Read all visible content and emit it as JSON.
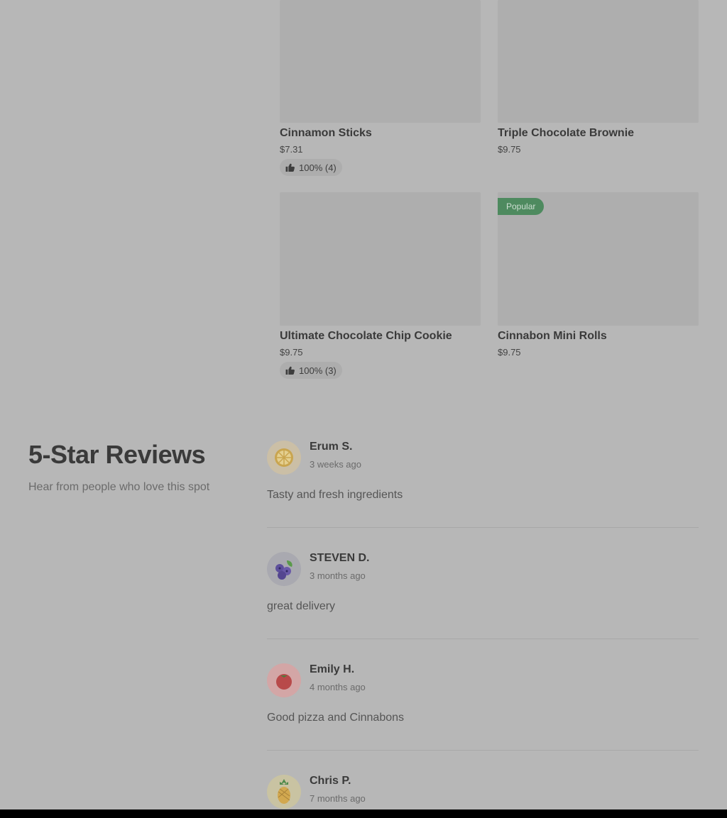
{
  "products": [
    {
      "name": "Cinnamon Sticks",
      "price": "$7.31",
      "rating": "100% (4)"
    },
    {
      "name": "Triple Chocolate Brownie",
      "price": "$9.75"
    },
    {
      "name": "Ultimate Chocolate Chip Cookie",
      "price": "$9.75",
      "rating": "100% (3)"
    },
    {
      "name": "Cinnabon Mini Rolls",
      "price": "$9.75",
      "badge": "Popular"
    }
  ],
  "reviews_section": {
    "title": "5-Star Reviews",
    "subtitle": "Hear from people who love this spot",
    "reviews": [
      {
        "author": "Erum S.",
        "when": "3 weeks ago",
        "text": "Tasty and fresh ingredients",
        "avatar_icon": "lemon-icon"
      },
      {
        "author": "STEVEN D.",
        "when": "3 months ago",
        "text": "great delivery",
        "avatar_icon": "blueberries-icon"
      },
      {
        "author": "Emily H.",
        "when": "4 months ago",
        "text": "Good pizza and Cinnabons",
        "avatar_icon": "tomato-icon"
      },
      {
        "author": "Chris P.",
        "when": "7 months ago",
        "avatar_icon": "pineapple-icon"
      }
    ]
  },
  "colors": {
    "overlay_background": "#b7b7b7",
    "badge_green": "#4e8a5f"
  }
}
